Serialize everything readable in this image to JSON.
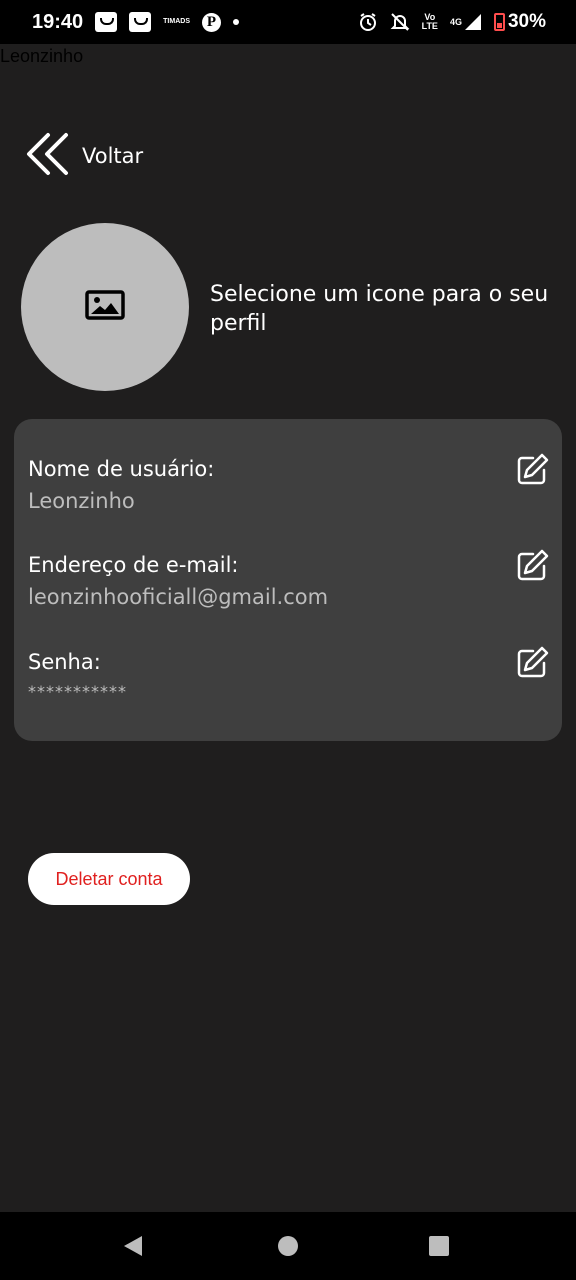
{
  "status_bar": {
    "time": "19:40",
    "carrier_top": "TIM",
    "carrier_bottom": "ADS",
    "volte_top": "Vo",
    "volte_bottom": "LTE",
    "network": "4G",
    "battery_percent": "30%"
  },
  "app_title": "Leonzinho",
  "back": {
    "label": "Voltar"
  },
  "profile": {
    "avatar_icon": "image-icon",
    "hint": "Selecione um icone para o seu perfil"
  },
  "fields": [
    {
      "label": "Nome de usuário:",
      "value": "Leonzinho"
    },
    {
      "label": "Endereço de e-mail:",
      "value": "leonzinhooficiall@gmail.com"
    },
    {
      "label": "Senha:",
      "value": "***********"
    }
  ],
  "delete_button": {
    "label": "Deletar conta"
  },
  "colors": {
    "background": "#1f1e1e",
    "card": "#3f3f3f",
    "avatar": "#bdbdbd",
    "danger": "#e0201f"
  }
}
